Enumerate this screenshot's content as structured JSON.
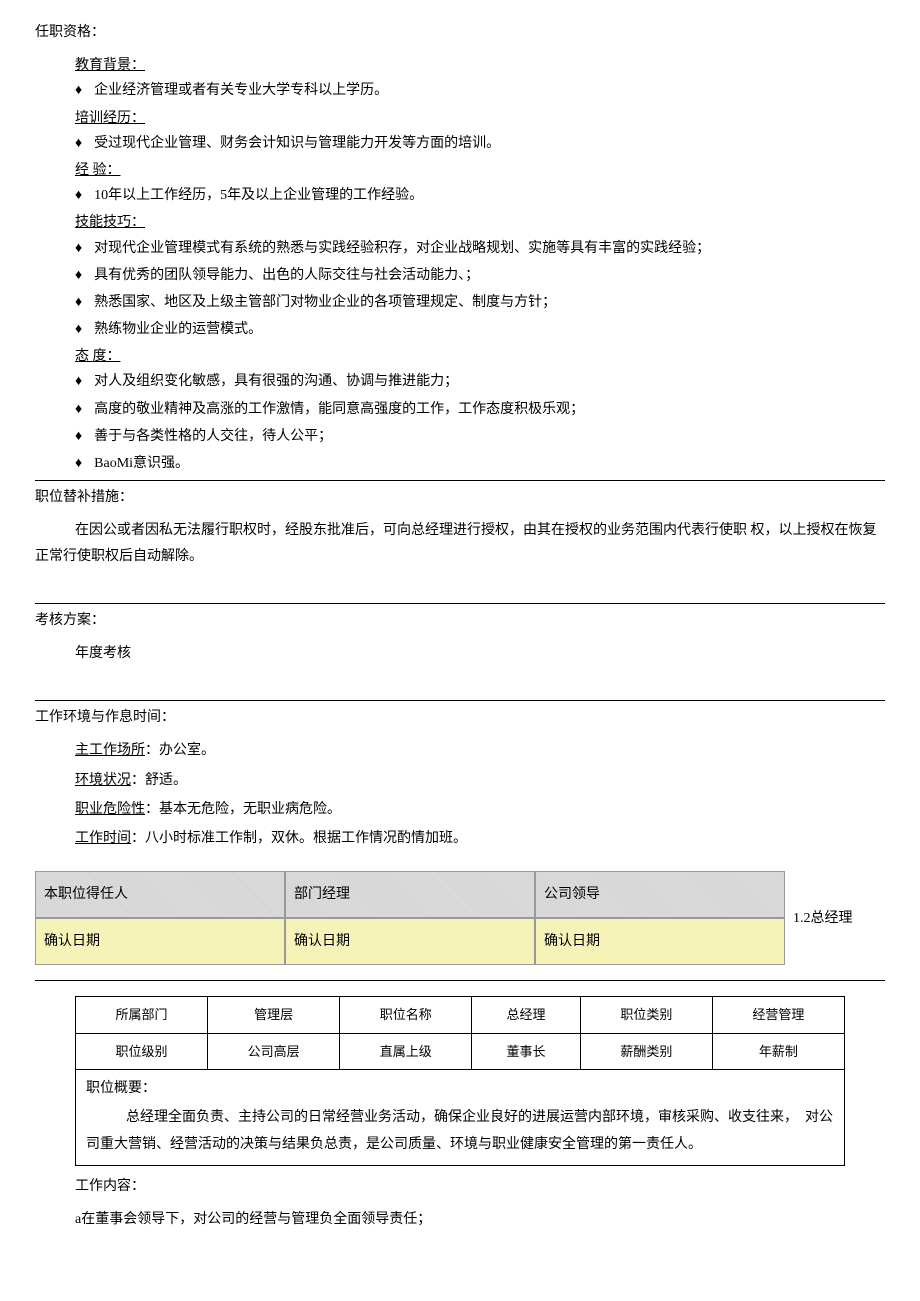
{
  "qualifications": {
    "title": "任职资格：",
    "education": {
      "label": "教育背景",
      "items": [
        "企业经济管理或者有关专业大学专科以上学历。"
      ]
    },
    "training": {
      "label": "培训经历",
      "items": [
        "受过现代企业管理、财务会计知识与管理能力开发等方面的培训。"
      ]
    },
    "experience": {
      "label": "经  验",
      "items": [
        "10年以上工作经历，5年及以上企业管理的工作经验。"
      ]
    },
    "skills": {
      "label": "技能技巧",
      "items": [
        "对现代企业管理模式有系统的熟悉与实践经验积存，对企业战略规划、实施等具有丰富的实践经验；",
        "具有优秀的团队领导能力、出色的人际交往与社会活动能力、；",
        "熟悉国家、地区及上级主管部门对物业企业的各项管理规定、制度与方针；",
        "熟练物业企业的运营模式。"
      ]
    },
    "attitude": {
      "label": "态  度",
      "items": [
        "对人及组织变化敏感，具有很强的沟通、协调与推进能力；",
        "高度的敬业精神及高涨的工作激情，能同意高强度的工作，工作态度积极乐观；",
        "善于与各类性格的人交往，待人公平；",
        "BaoMi意识强。"
      ]
    }
  },
  "substitute": {
    "title": "职位替补措施：",
    "text": "在因公或者因私无法履行职权时，经股东批准后，可向总经理进行授权，由其在授权的业务范围内代表行使职 权，以上授权在恢复正常行使职权后自动解除。"
  },
  "assessment": {
    "title": "考核方案：",
    "text": "年度考核"
  },
  "environment": {
    "title": "工作环境与作息时间：",
    "workplace_label": "主工作场所",
    "workplace_value": "：办公室。",
    "condition_label": "环境状况",
    "condition_value": "：舒适。",
    "risk_label": "职业危险性",
    "risk_value": "：基本无危险，无职业病危险。",
    "worktime_label": "工作时间",
    "worktime_value": "：八小时标准工作制，双休。根据工作情况酌情加班。"
  },
  "signature": {
    "header1": "本职位得任人",
    "header2": "部门经理",
    "header3": "公司领导",
    "confirm": "确认日期",
    "section_label": "1.2总经理"
  },
  "info": {
    "dept_label": "所属部门",
    "dept_value": "管理层",
    "pos_name_label": "职位名称",
    "pos_name_value": "总经理",
    "pos_cat_label": "职位类别",
    "pos_cat_value": "经营管理",
    "level_label": "职位级别",
    "level_value": "公司高层",
    "superior_label": "直属上级",
    "superior_value": "董事长",
    "salary_label": "薪酬类别",
    "salary_value": "年薪制"
  },
  "summary": {
    "title": "职位概要：",
    "text": "总经理全面负责、主持公司的日常经营业务活动，确保企业良好的进展运营内部环境，审核采购、收支往来，　对公司重大营销、经营活动的决策与结果负总责，是公司质量、环境与职业健康安全管理的第一责任人。"
  },
  "work_content": {
    "title": "工作内容：",
    "item_a": "a在董事会领导下，对公司的经营与管理负全面领导责任；"
  }
}
